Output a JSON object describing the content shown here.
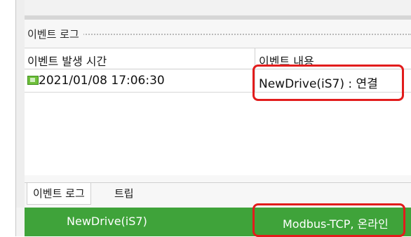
{
  "event_log": {
    "title": "이벤트 로그",
    "columns": [
      "이벤트 발생 시간",
      "이벤트 내용"
    ],
    "rows": [
      {
        "time": "2021/01/08 17:06:30",
        "content": "NewDrive(iS7) : 연결"
      }
    ]
  },
  "tabs": [
    {
      "label": "이벤트 로그",
      "active": true
    },
    {
      "label": "트립",
      "active": false
    }
  ],
  "status_bar": {
    "device": "NewDrive(iS7)",
    "connection": "Modbus-TCP, 온라인",
    "color": "#3fa33a"
  },
  "highlight_color": "#e21c1c"
}
